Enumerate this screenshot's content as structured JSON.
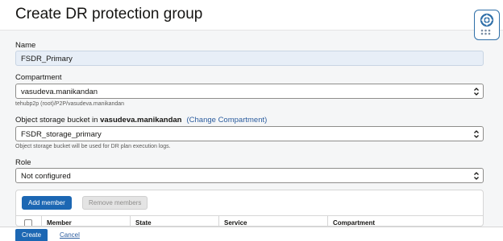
{
  "dialog": {
    "title": "Create DR protection group"
  },
  "form": {
    "name": {
      "label": "Name",
      "value": "FSDR_Primary"
    },
    "compartment": {
      "label": "Compartment",
      "value": "vasudeva.manikandan",
      "helper": "tehubp2p (root)/P2P/vasudeva.manikandan"
    },
    "bucket": {
      "label_prefix": "Object storage bucket in ",
      "label_compartment": "vasudeva.manikandan",
      "change_link": "(Change Compartment)",
      "value": "FSDR_storage_primary",
      "helper": "Object storage bucket will be used for DR plan execution logs."
    },
    "role": {
      "label": "Role",
      "value": "Not configured"
    }
  },
  "members": {
    "add_button": "Add member",
    "remove_button": "Remove members",
    "columns": [
      "Member",
      "State",
      "Service",
      "Compartment"
    ]
  },
  "footer": {
    "create_button": "Create",
    "cancel_link": "Cancel"
  },
  "colors": {
    "primary": "#1c67b3",
    "link": "#2b5c9e",
    "filled_input": "#e7eef7"
  },
  "icons": {
    "help": "lifebuoy-icon",
    "select": "chevron-updown-icon"
  }
}
